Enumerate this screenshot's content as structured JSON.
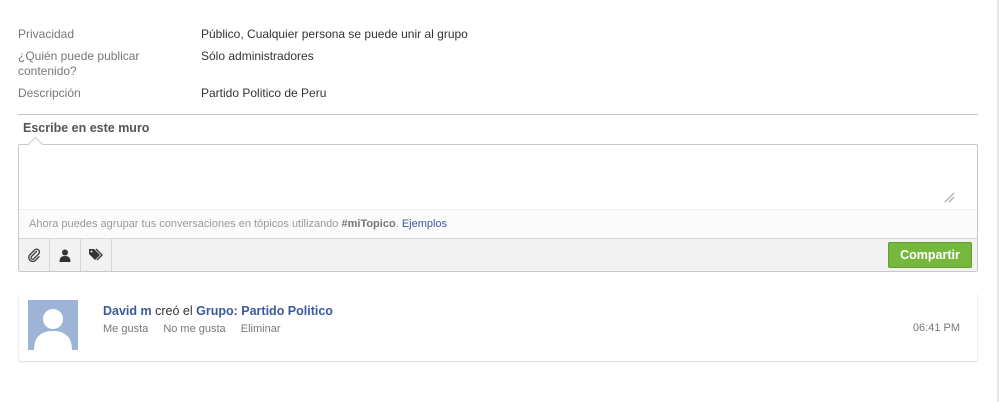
{
  "info": {
    "rows": [
      {
        "label": "Privacidad",
        "value": "Público, Cualquier persona se puede unir al grupo"
      },
      {
        "label": "¿Quién puede publicar contenido?",
        "value": "Sólo administradores"
      },
      {
        "label": "Descripción",
        "value": "Partido Politico de Peru"
      }
    ]
  },
  "composer": {
    "title": "Escribe en este muro",
    "input_value": "",
    "hint_prefix": "Ahora puedes agrupar tus conversaciones en tópicos utilizando ",
    "hint_tag": "#miTopico",
    "hint_period": ".",
    "hint_link": "Ejemplos",
    "tools": [
      "paperclip-icon",
      "person-icon",
      "tags-icon"
    ],
    "share_label": "Compartir"
  },
  "feed": {
    "item": {
      "author": "David m",
      "verb": "creó el",
      "target": "Grupo: Partido Politico",
      "actions": [
        "Me gusta",
        "No me gusta",
        "Eliminar"
      ],
      "time": "06:41 PM"
    }
  },
  "colors": {
    "link": "#3b5998",
    "share_button": "#76b83b",
    "avatar_bg": "#9eb4d6"
  }
}
